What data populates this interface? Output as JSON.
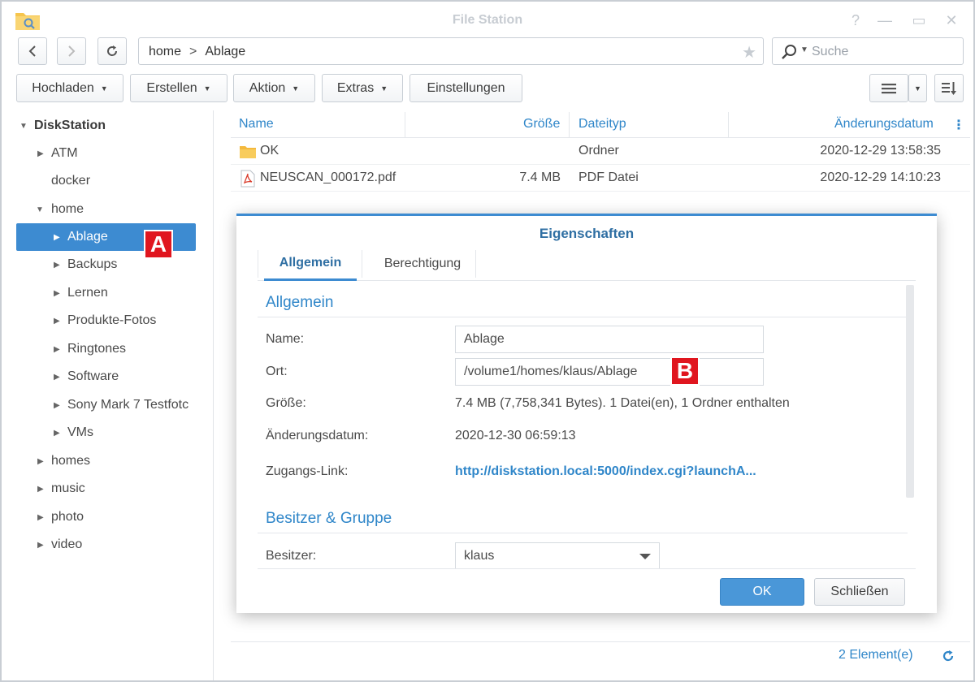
{
  "window": {
    "title": "File Station",
    "app_icon": "folder-search-icon"
  },
  "toolbar": {
    "path": [
      "home",
      "Ablage"
    ],
    "path_separator": ">",
    "search_placeholder": "Suche",
    "buttons": {
      "upload": "Hochladen",
      "create": "Erstellen",
      "action": "Aktion",
      "extras": "Extras",
      "settings": "Einstellungen"
    }
  },
  "sidebar": {
    "root": "DiskStation",
    "items": [
      {
        "label": "ATM",
        "level": 1,
        "arrow": "collapsed"
      },
      {
        "label": "docker",
        "level": 1,
        "arrow": "none"
      },
      {
        "label": "home",
        "level": 1,
        "arrow": "expanded"
      },
      {
        "label": "Ablage",
        "level": 2,
        "arrow": "collapsed",
        "selected": true
      },
      {
        "label": "Backups",
        "level": 2,
        "arrow": "collapsed"
      },
      {
        "label": "Lernen",
        "level": 2,
        "arrow": "collapsed"
      },
      {
        "label": "Produkte-Fotos",
        "level": 2,
        "arrow": "collapsed"
      },
      {
        "label": "Ringtones",
        "level": 2,
        "arrow": "collapsed"
      },
      {
        "label": "Software",
        "level": 2,
        "arrow": "collapsed"
      },
      {
        "label": "Sony Mark 7 Testfotc",
        "level": 2,
        "arrow": "collapsed"
      },
      {
        "label": "VMs",
        "level": 2,
        "arrow": "collapsed"
      },
      {
        "label": "homes",
        "level": 1,
        "arrow": "collapsed"
      },
      {
        "label": "music",
        "level": 1,
        "arrow": "collapsed"
      },
      {
        "label": "photo",
        "level": 1,
        "arrow": "collapsed"
      },
      {
        "label": "video",
        "level": 1,
        "arrow": "collapsed"
      }
    ]
  },
  "file_list": {
    "columns": [
      "Name",
      "Größe",
      "Dateityp",
      "Änderungsdatum"
    ],
    "rows": [
      {
        "name": "OK",
        "size": "",
        "type": "Ordner",
        "date": "2020-12-29 13:58:35",
        "icon": "folder-icon"
      },
      {
        "name": "NEUSCAN_000172.pdf",
        "size": "7.4 MB",
        "type": "PDF Datei",
        "date": "2020-12-29 14:10:23",
        "icon": "pdf-icon"
      }
    ]
  },
  "status": {
    "count": "2 Element(e)"
  },
  "dialog": {
    "title": "Eigenschaften",
    "tabs": [
      "Allgemein",
      "Berechtigung"
    ],
    "active_tab": "Allgemein",
    "section_general": "Allgemein",
    "labels": {
      "name": "Name:",
      "location": "Ort:",
      "size": "Größe:",
      "modified": "Änderungsdatum:",
      "access_link": "Zugangs-Link:",
      "owner": "Besitzer:"
    },
    "values": {
      "name": "Ablage",
      "location": "/volume1/homes/klaus/Ablage",
      "size": "7.4 MB (7,758,341 Bytes). 1 Datei(en), 1 Ordner enthalten",
      "modified": "2020-12-30 06:59:13",
      "access_link": "http://diskstation.local:5000/index.cgi?launchA...",
      "owner": "klaus"
    },
    "section_owner": "Besitzer & Gruppe",
    "ok": "OK",
    "close": "Schließen"
  },
  "markers": {
    "a": "A",
    "b": "B"
  },
  "colors": {
    "accent": "#3d8bd1",
    "link": "#2f86c9",
    "marker": "#e0161f"
  }
}
